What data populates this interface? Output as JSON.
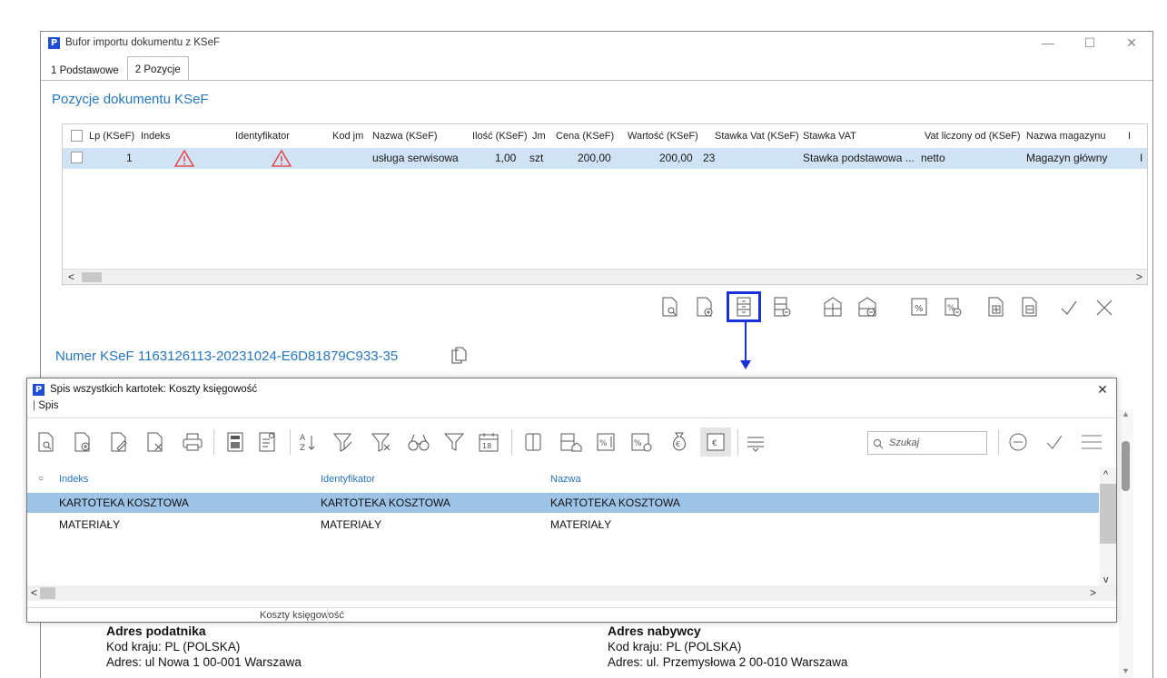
{
  "main_window": {
    "title": "Bufor importu dokumentu z KSeF",
    "tabs": [
      "1 Podstawowe",
      "2 Pozycje"
    ],
    "section_title": "Pozycje dokumentu KSeF",
    "columns": [
      "Lp (KSeF)",
      "Indeks",
      "Identyfikator",
      "Kod jm",
      "Nazwa (KSeF)",
      "Ilość (KSeF)",
      "Jm",
      "Cena (KSeF)",
      "Wartość (KSeF)",
      "Stawka Vat (KSeF)",
      "Stawka VAT",
      "Vat liczony od (KSeF)",
      "Nazwa magazynu",
      "I"
    ],
    "row": {
      "lp": "1",
      "nazwa": "usługa serwisowa",
      "ilosc": "1,00",
      "jm": "szt",
      "cena": "200,00",
      "wartosc": "200,00",
      "stawka_ksef": "23",
      "stawka_vat": "Stawka podstawowa ...",
      "vat_od": "netto",
      "magazyn": "Magazyn główny",
      "extra": "I"
    },
    "ksef_number": "Numer KSeF 1163126113-20231024-E6D81879C933-35",
    "podatnik": {
      "title": "Adres podatnika",
      "kraj": "Kod kraju: PL  (POLSKA)",
      "adres": "Adres: ul Nowa 1 00-001 Warszawa"
    },
    "nabywca": {
      "title": "Adres nabywcy",
      "kraj": "Kod kraju: PL  (POLSKA)",
      "adres": "Adres: ul. Przemysłowa 2 00-010 Warszawa"
    }
  },
  "popup_window": {
    "title": "Spis wszystkich kartotek: Koszty księgowość",
    "menu": "Spis",
    "search_placeholder": "Szukaj",
    "columns": [
      "Indeks",
      "Identyfikator",
      "Nazwa"
    ],
    "rows": [
      [
        "KARTOTEKA  KOSZTOWA",
        "KARTOTEKA  KOSZTOWA",
        "KARTOTEKA  KOSZTOWA"
      ],
      [
        "MATERIAŁY",
        "MATERIAŁY",
        "MATERIAŁY"
      ]
    ],
    "status": "Koszty księgowość"
  },
  "colors": {
    "accent": "#2575c4",
    "highlight": "#1a31d9",
    "selected_row": "#9dc3e6",
    "row": "#cfe3f4"
  }
}
